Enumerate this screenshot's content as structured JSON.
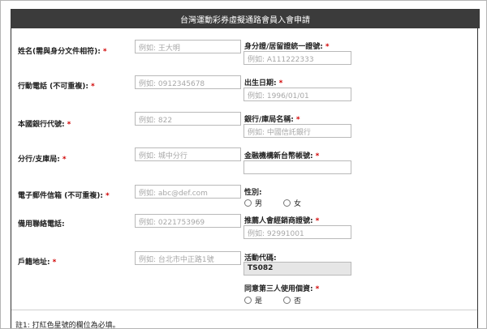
{
  "header": {
    "title": "台灣運動彩券虛擬通路會員入會申請"
  },
  "left_fields": [
    {
      "label": "姓名(需與身分文件相符):",
      "required": "*",
      "placeholder": "例如: 王大明"
    },
    {
      "label": "行動電話 (不可重複):",
      "required": "*",
      "placeholder": "例如: 0912345678"
    },
    {
      "label": "本國銀行代號:",
      "required": "*",
      "placeholder": "例如: 822"
    },
    {
      "label": "分行/支庫局:",
      "required": "*",
      "placeholder": "例如: 城中分行"
    },
    {
      "label": "電子郵件信箱 (不可重複):",
      "required": "*",
      "placeholder": "例如: abc@def.com"
    },
    {
      "label": "備用聯絡電話:",
      "required": "",
      "placeholder": "例如: 0221753969"
    },
    {
      "label": "戶籍地址:",
      "required": "*",
      "placeholder": "例如: 台北市中正路1號"
    }
  ],
  "right_fields": [
    {
      "label": "身分證/居留證統一證號:",
      "required": "*",
      "placeholder": "例如: A111222333"
    },
    {
      "label": "出生日期:",
      "required": "*",
      "placeholder": "例如: 1996/01/01"
    },
    {
      "label": "銀行/庫局名稱:",
      "required": "*",
      "placeholder": "例如: 中國信託銀行"
    },
    {
      "label": "金融機構新台幣帳號:",
      "required": "*",
      "placeholder": ""
    },
    {
      "label": "推薦人會經銷商證號:",
      "required": "*",
      "placeholder": "例如: 92991001"
    },
    {
      "label": "活動代碼:",
      "required": "",
      "value": "TS082"
    }
  ],
  "gender": {
    "label": "性別:",
    "options": [
      "男",
      "女"
    ]
  },
  "consent": {
    "label": "同意第三人使用個資:",
    "required": "*",
    "options": [
      "是",
      "否"
    ]
  },
  "note": {
    "text": "註1: 打紅色星號的欄位為必填。"
  }
}
